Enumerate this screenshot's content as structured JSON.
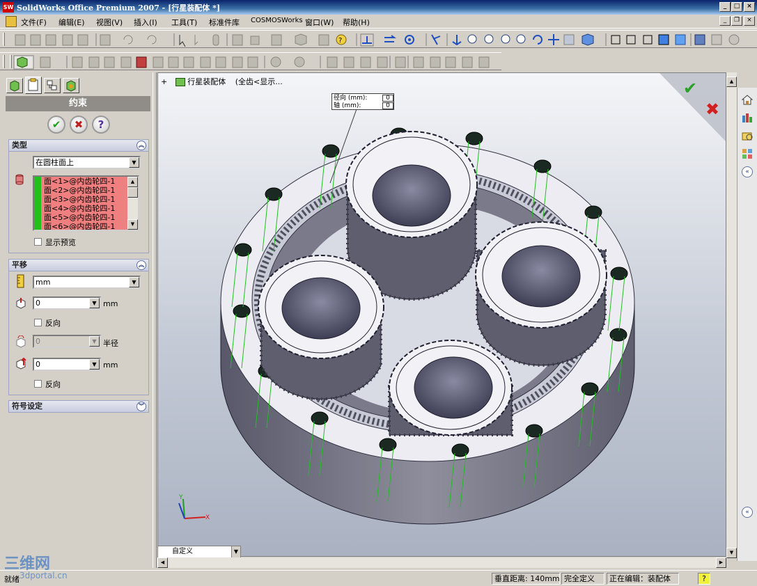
{
  "window": {
    "title": "SolidWorks Office Premium 2007 - [行星装配体 *]",
    "app_icon_text": "SW"
  },
  "menu": {
    "items": [
      "文件(F)",
      "编辑(E)",
      "视图(V)",
      "插入(I)",
      "工具(T)",
      "标准件库",
      "COSMOSWorks",
      "窗口(W)",
      "帮助(H)"
    ]
  },
  "property_manager": {
    "tabs": [
      "feature-manager",
      "property-manager",
      "configuration-manager",
      "display-manager"
    ],
    "header": "约束",
    "buttons": {
      "ok": "✔",
      "cancel": "✖",
      "help": "?"
    },
    "type_group": {
      "title": "类型",
      "type_value": "在圆柱面上",
      "faces": [
        "面<1>@内齿轮四-1",
        "面<2>@内齿轮四-1",
        "面<3>@内齿轮四-1",
        "面<4>@内齿轮四-1",
        "面<5>@内齿轮四-1",
        "面<6>@内齿轮四-1"
      ],
      "show_preview_label": "显示预览",
      "show_preview_checked": false
    },
    "translation_group": {
      "title": "平移",
      "unit_value": "mm",
      "distance1_value": "0",
      "distance1_unit": "mm",
      "reverse1_label": "反向",
      "radius_value": "0",
      "radius_unit": "半径",
      "distance2_value": "0",
      "distance2_unit": "mm",
      "reverse2_label": "反向"
    },
    "symbol_group": {
      "title": "符号设定"
    }
  },
  "viewport": {
    "tree_expand": "+",
    "tree_label": "行星装配体",
    "tree_suffix": "(全齿<显示...",
    "callout": {
      "radial_label": "径向 (mm):",
      "radial_value": "0",
      "axial_label": "轴 (mm):",
      "axial_value": "0"
    },
    "confirm_ok": "✔",
    "confirm_cancel": "✖",
    "triad_x": "X",
    "triad_y": "Y",
    "config_value": "自定义"
  },
  "status_bar": {
    "left": "就绪",
    "distance": "垂直距离: 140mm",
    "definition": "完全定义",
    "editing": "正在编辑：装配体",
    "help": "?"
  },
  "watermark": {
    "logo": "三维网",
    "site": "3dportal.cn"
  },
  "colors": {
    "title_bar": "#0a246a",
    "pm_header": "#908c88",
    "face_list": "#f08080",
    "gear_face": "#e8e8f0",
    "gear_side": "#6e6e7a",
    "sketch_green": "#20c020"
  }
}
